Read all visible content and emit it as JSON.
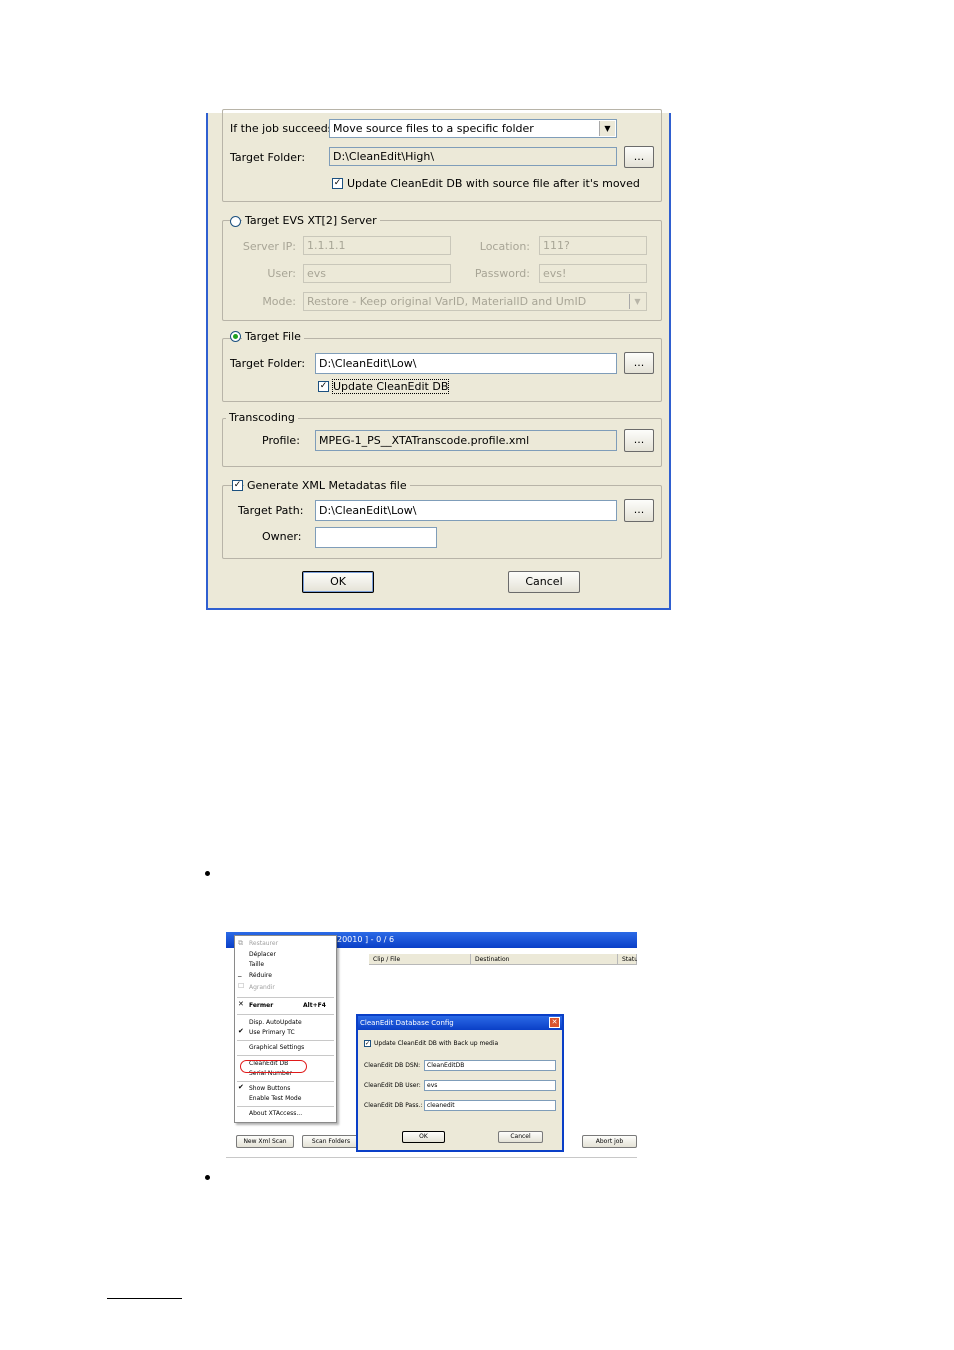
{
  "job_dialog": {
    "success": {
      "label": "If the job succeeds:",
      "action_value": "Move source files to a specific folder",
      "target_folder_label": "Target Folder:",
      "target_folder_value": "D:\\CleanEdit\\High\\",
      "browse_label": "...",
      "update_db_label": "Update CleanEdit DB with source file after it's moved"
    },
    "evs_server": {
      "legend": "Target EVS XT[2] Server",
      "server_ip_label": "Server IP:",
      "server_ip_value": "1.1.1.1",
      "location_label": "Location:",
      "location_value": "111?",
      "user_label": "User:",
      "user_value": "evs",
      "password_label": "Password:",
      "password_value": "evs!",
      "mode_label": "Mode:",
      "mode_value": "Restore - Keep original VarID, MaterialID and UmID"
    },
    "target_file": {
      "legend": "Target File",
      "folder_label": "Target Folder:",
      "folder_value": "D:\\CleanEdit\\Low\\",
      "browse_label": "...",
      "update_db_label": "Update CleanEdit DB"
    },
    "transcoding": {
      "legend": "Transcoding",
      "profile_label": "Profile:",
      "profile_value": "MPEG-1_PS__XTATranscode.profile.xml",
      "browse_label": "..."
    },
    "xml_metadata": {
      "legend": "Generate XML Metadatas file",
      "path_label": "Target Path:",
      "path_value": "D:\\CleanEdit\\Low\\",
      "browse_label": "...",
      "owner_label": "Owner:",
      "owner_value": ""
    },
    "ok_label": "OK",
    "cancel_label": "Cancel"
  },
  "screenshot2": {
    "window_title": "20010 ] - 0 / 6",
    "columns": [
      "Clip / File",
      "Destination",
      "Statu"
    ],
    "menu_items": {
      "restaurer": "Restaurer",
      "deplacer": "Déplacer",
      "taille": "Taille",
      "reduire": "Réduire",
      "agrandir": "Agrandir",
      "fermer": "Fermer",
      "fermer_shortcut": "Alt+F4",
      "disp_autoupdate": "Disp. AutoUpdate",
      "use_primary_tc": "Use Primary TC",
      "graphical_settings": "Graphical Settings",
      "cleanedit_db": "CleanEdit DB",
      "serial_number": "Serial Number",
      "show_buttons": "Show Buttons",
      "enable_test_mode": "Enable Test Mode",
      "about": "About XTAccess..."
    },
    "config_dialog": {
      "title": "CleanEdit Database Config",
      "update_label": "Update CleanEdit DB with Back up media",
      "dsn_label": "CleanEdit DB DSN:",
      "dsn_value": "CleanEditDB",
      "user_label": "CleanEdit DB User:",
      "user_value": "evs",
      "pass_label": "CleanEdit DB Pass.:",
      "pass_value": "cleanedit",
      "ok_label": "OK",
      "cancel_label": "Cancel"
    },
    "bottom_buttons": {
      "new_xml_scan": "New Xml Scan",
      "scan_folders": "Scan Folders",
      "abort_job": "Abort job"
    }
  },
  "accent_colors": {
    "dialog_border": "#2f5fd0",
    "xp_title": "#0a3fc7",
    "highlight_ring": "#e01a1a"
  }
}
